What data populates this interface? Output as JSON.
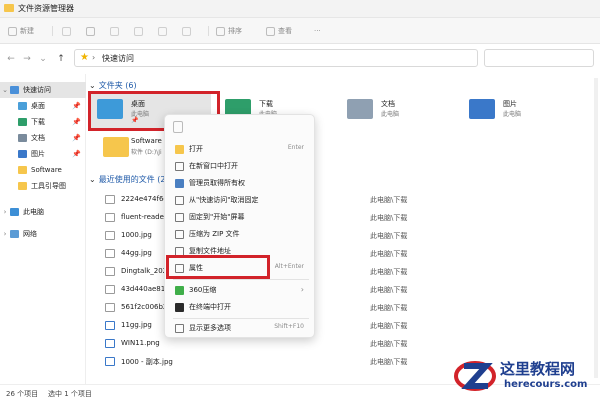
{
  "window": {
    "title": "文件资源管理器"
  },
  "toolbar": {
    "new_label": "新建",
    "sort_label": "排序",
    "view_label": "查看",
    "more_label": "···"
  },
  "address": {
    "path": "快速访问"
  },
  "sidebar": {
    "items": [
      {
        "label": "快速访问"
      },
      {
        "label": "桌面"
      },
      {
        "label": "下载"
      },
      {
        "label": "文档"
      },
      {
        "label": "图片"
      },
      {
        "label": "Software"
      },
      {
        "label": "工具引导图"
      },
      {
        "label": "此电脑"
      },
      {
        "label": "网络"
      }
    ]
  },
  "folders": {
    "header": "文件夹 (6)",
    "items": [
      {
        "name": "桌面",
        "sub": "此电脑"
      },
      {
        "name": "下载",
        "sub": "此电脑"
      },
      {
        "name": "文档",
        "sub": "此电脑"
      },
      {
        "name": "图片",
        "sub": "此电脑"
      },
      {
        "name": "Software",
        "sub": "软件 (D:)\\Ji"
      }
    ]
  },
  "recent": {
    "header": "最近使用的文件 (20",
    "rows": [
      {
        "name": "2224e474f6e",
        "loc": "此电脑\\下载"
      },
      {
        "name": "fluent-reader.",
        "loc": "此电脑\\下载"
      },
      {
        "name": "1000.jpg",
        "loc": "此电脑\\下载"
      },
      {
        "name": "44gg.jpg",
        "loc": "此电脑\\下载"
      },
      {
        "name": "Dingtalk_2022",
        "loc": "此电脑\\下载"
      },
      {
        "name": "43d440ae819",
        "loc": "此电脑\\下载"
      },
      {
        "name": "561f2c006b24",
        "loc": "此电脑\\下载"
      },
      {
        "name": "11gg.jpg",
        "loc": "此电脑\\下载"
      },
      {
        "name": "WIN11.png",
        "loc": "此电脑\\下载"
      },
      {
        "name": "1000 - 副本.jpg",
        "loc": "此电脑\\下载"
      }
    ]
  },
  "context_menu": {
    "items": [
      {
        "label": "打开",
        "shortcut": "Enter"
      },
      {
        "label": "在新窗口中打开",
        "shortcut": ""
      },
      {
        "label": "管理员取得所有权",
        "shortcut": ""
      },
      {
        "label": "从\"快速访问\"取消固定",
        "shortcut": ""
      },
      {
        "label": "固定到\"开始\"屏幕",
        "shortcut": ""
      },
      {
        "label": "压缩为 ZIP 文件",
        "shortcut": ""
      },
      {
        "label": "复制文件地址",
        "shortcut": ""
      },
      {
        "label": "属性",
        "shortcut": "Alt+Enter"
      },
      {
        "label": "360压缩",
        "shortcut": ""
      },
      {
        "label": "在终端中打开",
        "shortcut": ""
      },
      {
        "label": "显示更多选项",
        "shortcut": "Shift+F10"
      }
    ]
  },
  "status": {
    "count": "26 个项目",
    "selected": "选中 1 个项目"
  },
  "watermark": {
    "cn": "这里教程网",
    "en": "herecours.com"
  },
  "colors": {
    "highlight": "#d2232a",
    "folder": "#f6c64c",
    "accent": "#1f5aa8"
  }
}
